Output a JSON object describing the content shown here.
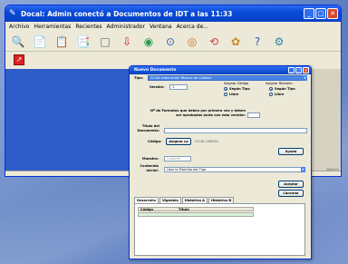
{
  "main_window": {
    "title": "Docal: Admin conectó a Documentos de IDT a las 11:33",
    "menu": [
      "Archivo",
      "Herramientas",
      "Recientes",
      "Administrador",
      "Ventana",
      "Acerca de..."
    ],
    "toolbar_icons": [
      "search-icon",
      "new-doc-icon",
      "templates-icon",
      "reports-icon",
      "blank-page-icon",
      "export-icon",
      "globe-icon",
      "disk-icon",
      "media-icon",
      "refresh-icon",
      "tools-icon",
      "help-icon",
      "settings-icon"
    ],
    "status_text": "MAYÚS"
  },
  "dialog": {
    "title": "Nuevo Documento",
    "tipo_label": "Tipo:",
    "tipo_value": "IT-CAL Instrucción Técnica de Calidad",
    "version_label": "Versión:",
    "version_value": "1",
    "asignar_codigo_label": "Asignar Código",
    "asignar_codigo_options": [
      "Según Tipo",
      "Libre"
    ],
    "asignar_revision_label": "Asignar Revisión",
    "asignar_revision_options": [
      "Según Tipo",
      "Libre"
    ],
    "formatos_label": "Nº de Formatos que deben por primera vez y deben ser aprobados junto con esta versión:",
    "titulo_label": "Título del Documento:",
    "codigo_label": "Código:",
    "asignar_button": "Asignar co",
    "codigo_value": "IT-CAL-000001",
    "ayuda_button": "Ayuda",
    "muestra_label": "Muestra:",
    "muestra_value": "Carácter",
    "contenido_label": "Contenido Inicial:",
    "contenido_value": "Usar la Plantilla del Tipo",
    "aceptar_button": "Aceptar",
    "cancelar_button": "Cancelar",
    "tabs": [
      "Desarrollo",
      "Vigentes",
      "Histórico A",
      "Histórico B"
    ],
    "grid_columns": [
      "Código",
      "Título"
    ]
  }
}
